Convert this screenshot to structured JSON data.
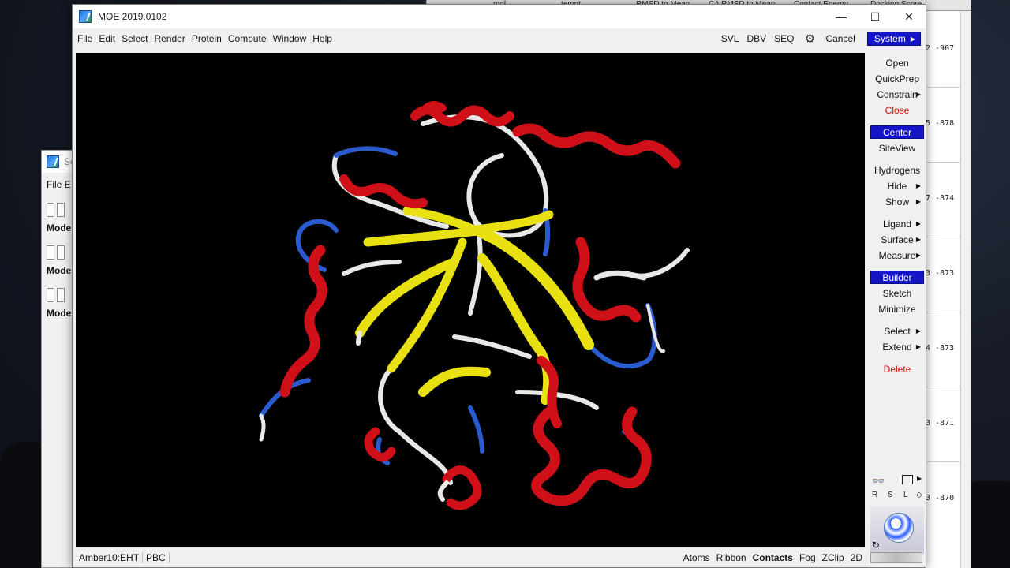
{
  "window": {
    "title": "MOE 2019.0102",
    "minimize": "—",
    "maximize": "☐",
    "close": "✕"
  },
  "menubar": {
    "items": [
      {
        "label": "File",
        "underline_char": "F"
      },
      {
        "label": "Edit",
        "underline_char": "E"
      },
      {
        "label": "Select",
        "underline_char": "S"
      },
      {
        "label": "Render",
        "underline_char": "R"
      },
      {
        "label": "Protein",
        "underline_char": "P"
      },
      {
        "label": "Compute",
        "underline_char": "C"
      },
      {
        "label": "Window",
        "underline_char": "W"
      },
      {
        "label": "Help",
        "underline_char": "H"
      }
    ],
    "right": {
      "svl": "SVL",
      "dbv": "DBV",
      "seq": "SEQ",
      "cancel": "Cancel",
      "system": "System"
    }
  },
  "right_panel": {
    "buttons": [
      {
        "label": "Open",
        "style": "normal",
        "arrow": false
      },
      {
        "label": "QuickPrep",
        "style": "normal",
        "arrow": false
      },
      {
        "label": "Constrain",
        "style": "normal",
        "arrow": true
      },
      {
        "label": "Close",
        "style": "red",
        "arrow": false
      },
      {
        "label": "Center",
        "style": "active",
        "arrow": false
      },
      {
        "label": "SiteView",
        "style": "normal",
        "arrow": false
      },
      {
        "label": "Hydrogens",
        "style": "normal",
        "arrow": false
      },
      {
        "label": "Hide",
        "style": "normal",
        "arrow": true
      },
      {
        "label": "Show",
        "style": "normal",
        "arrow": true
      },
      {
        "label": "Ligand",
        "style": "normal",
        "arrow": true
      },
      {
        "label": "Surface",
        "style": "normal",
        "arrow": true
      },
      {
        "label": "Measure",
        "style": "normal",
        "arrow": true
      },
      {
        "label": "Builder",
        "style": "active",
        "arrow": false
      },
      {
        "label": "Sketch",
        "style": "normal",
        "arrow": false
      },
      {
        "label": "Minimize",
        "style": "normal",
        "arrow": false
      },
      {
        "label": "Select",
        "style": "normal",
        "arrow": true
      },
      {
        "label": "Extend",
        "style": "normal",
        "arrow": true
      },
      {
        "label": "Delete",
        "style": "red",
        "arrow": false
      }
    ],
    "rsl": [
      "R",
      "S",
      "L"
    ]
  },
  "statusbar": {
    "forcefield": "Amber10:EHT",
    "pbc": "PBC",
    "right": [
      "Atoms",
      "Ribbon",
      "Contacts",
      "Fog",
      "ZClip",
      "2D"
    ],
    "bold_item": "Contacts"
  },
  "background_table": {
    "headers": [
      "mol",
      "tempt",
      "RMSD to Mean",
      "CA RMSD to Mean",
      "Contact Energy",
      "Docking Score"
    ],
    "values": [
      "2 -907",
      "5 -878",
      "7 -874",
      "3 -873",
      "4 -873",
      "3 -871",
      "3 -870"
    ]
  },
  "background_seq_window": {
    "title": "Se",
    "menu": "File  E",
    "model_label": "Mode"
  },
  "colors": {
    "viewport_bg": "#000000",
    "helix": "#d01018",
    "strand": "#e8e010",
    "coil": "#f0f0f0",
    "turn": "#2a5cd0",
    "accent": "#1515c8"
  }
}
